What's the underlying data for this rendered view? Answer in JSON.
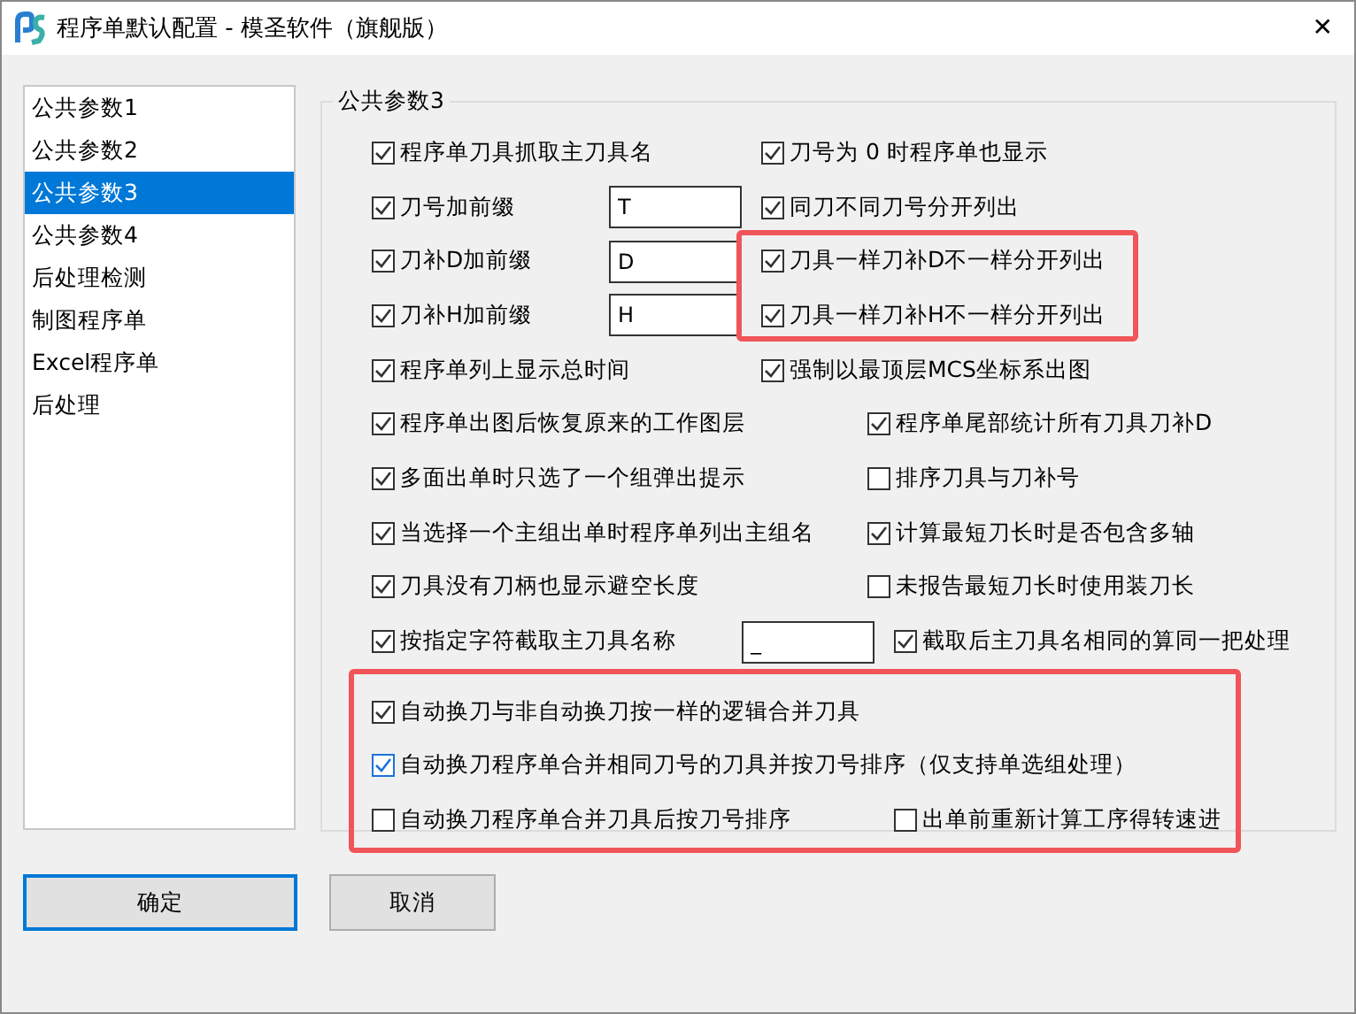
{
  "window": {
    "title": "程序单默认配置 - 模圣软件（旗舰版）",
    "close": "✕"
  },
  "sidebar": {
    "items": [
      {
        "label": "公共参数1",
        "selected": false
      },
      {
        "label": "公共参数2",
        "selected": false
      },
      {
        "label": "公共参数3",
        "selected": true
      },
      {
        "label": "公共参数4",
        "selected": false
      },
      {
        "label": "后处理检测",
        "selected": false
      },
      {
        "label": "制图程序单",
        "selected": false
      },
      {
        "label": "Excel程序单",
        "selected": false
      },
      {
        "label": "后处理",
        "selected": false
      }
    ]
  },
  "group": {
    "title": "公共参数3",
    "rows": [
      {
        "kind": "narrow",
        "left": {
          "label": "程序单刀具抓取主刀具名",
          "checked": true
        },
        "right": {
          "label": "刀号为 0 时程序单也显示",
          "checked": true
        }
      },
      {
        "kind": "narrow",
        "left": {
          "label": "刀号加前缀",
          "checked": true,
          "value": "T"
        },
        "right": {
          "label": "同刀不同刀号分开列出",
          "checked": true
        }
      },
      {
        "kind": "narrow",
        "left": {
          "label": "刀补D加前缀",
          "checked": true,
          "value": "D"
        },
        "right": {
          "label": "刀具一样刀补D不一样分开列出",
          "checked": true,
          "highlighted": true
        }
      },
      {
        "kind": "narrow",
        "left": {
          "label": "刀补H加前缀",
          "checked": true,
          "value": "H"
        },
        "right": {
          "label": "刀具一样刀补H不一样分开列出",
          "checked": true,
          "highlighted": true
        }
      },
      {
        "kind": "narrow",
        "left": {
          "label": "程序单列上显示总时间",
          "checked": true
        },
        "right": {
          "label": "强制以最顶层MCS坐标系出图",
          "checked": true
        }
      },
      {
        "kind": "wide",
        "left": {
          "label": "程序单出图后恢复原来的工作图层",
          "checked": true
        },
        "right": {
          "label": "程序单尾部统计所有刀具刀补D",
          "checked": true
        }
      },
      {
        "kind": "wide",
        "left": {
          "label": "多面出单时只选了一个组弹出提示",
          "checked": true
        },
        "right": {
          "label": "排序刀具与刀补号",
          "checked": false
        }
      },
      {
        "kind": "wide",
        "left": {
          "label": "当选择一个主组出单时程序单列出主组名",
          "checked": true
        },
        "right": {
          "label": "计算最短刀长时是否包含多轴",
          "checked": true
        }
      },
      {
        "kind": "wide",
        "left": {
          "label": "刀具没有刀柄也显示避空长度",
          "checked": true
        },
        "right": {
          "label": "未报告最短刀长时使用装刀长",
          "checked": false
        }
      },
      {
        "kind": "widest",
        "left": {
          "label": "按指定字符截取主刀具名称",
          "checked": true,
          "value": "_"
        },
        "right": {
          "label": "截取后主刀具名相同的算同一把处理",
          "checked": true
        }
      }
    ],
    "section": {
      "highlighted": true,
      "rows": [
        {
          "kind": "widest",
          "left": {
            "label": "自动换刀与非自动换刀按一样的逻辑合并刀具",
            "checked": true
          }
        },
        {
          "kind": "widest",
          "left": {
            "label": "自动换刀程序单合并相同刀号的刀具并按刀号排序（仅支持单选组处理）",
            "checked": true,
            "focused": true
          }
        },
        {
          "kind": "widest",
          "left": {
            "label": "自动换刀程序单合并刀具后按刀号排序",
            "checked": false
          },
          "right": {
            "label": "出单前重新计算工序得转速进",
            "checked": false
          }
        }
      ]
    }
  },
  "buttons": [
    {
      "label": "确定",
      "default": true
    },
    {
      "label": "取消",
      "default": false
    }
  ]
}
